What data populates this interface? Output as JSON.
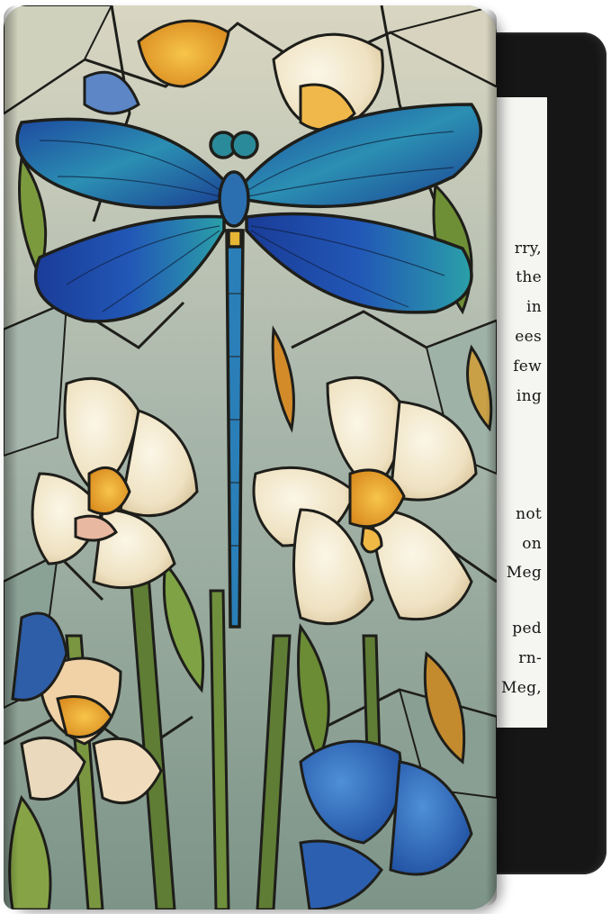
{
  "reader": {
    "lines": [
      "rry,",
      "the",
      "in",
      "ees",
      "few",
      "ing",
      "not",
      "on",
      "Meg",
      "ped",
      "rn-",
      "Meg,"
    ]
  },
  "colors": {
    "device_body": "#161616",
    "screen": "#f5f5f2",
    "leadline": "#1e1e1a",
    "wing_blue": "#1f4fa8",
    "wing_teal": "#2fa0b0",
    "petal_cream": "#f2e8d0",
    "petal_amber": "#e8a92a",
    "leaf_green": "#6f8a3a",
    "glass_grey": "#b9c2b6"
  },
  "icons": [
    "dragonfly-motif",
    "iris-flower-motif",
    "leaf-motif"
  ]
}
